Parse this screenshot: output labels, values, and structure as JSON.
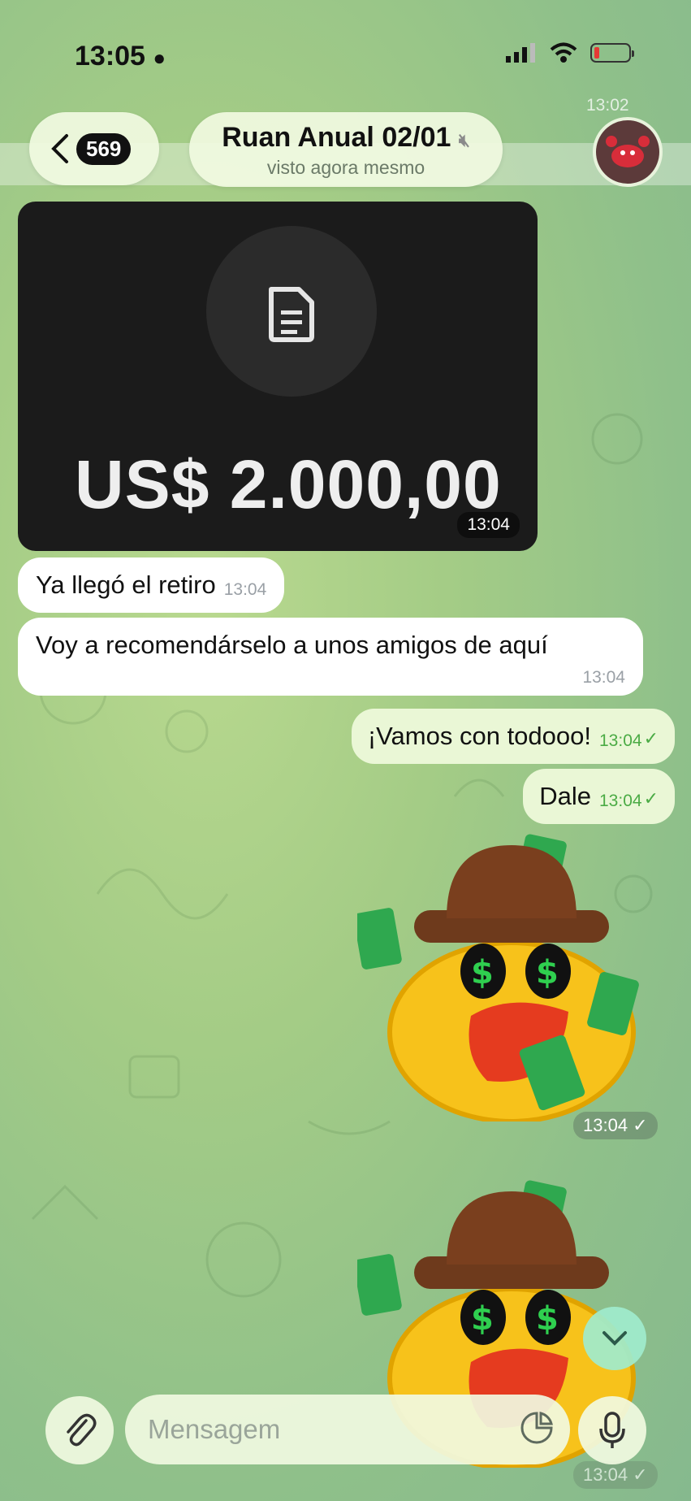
{
  "status": {
    "time": "13:05"
  },
  "header": {
    "back_count": "569",
    "chat_name": "Ruan Anual 02/01",
    "chat_status": "visto agora mesmo",
    "ghost_time": "13:02"
  },
  "messages": {
    "media": {
      "amount": "US$ 2.000,00",
      "time": "13:04"
    },
    "m1": {
      "text": "Ya llegó el retiro",
      "time": "13:04"
    },
    "m2": {
      "text": "Voy a recomendárselo a unos amigos de aquí",
      "time": "13:04"
    },
    "m3": {
      "text": "¡Vamos con todooo!",
      "time": "13:04"
    },
    "m4": {
      "text": "Dale",
      "time": "13:04"
    },
    "sticker1_time": "13:04",
    "sticker2_time": "13:04"
  },
  "composer": {
    "placeholder": "Mensagem"
  },
  "colors": {
    "outgoing_bubble": "#eaf7d6",
    "incoming_bubble": "#ffffff",
    "accent_green": "#4bab45"
  }
}
